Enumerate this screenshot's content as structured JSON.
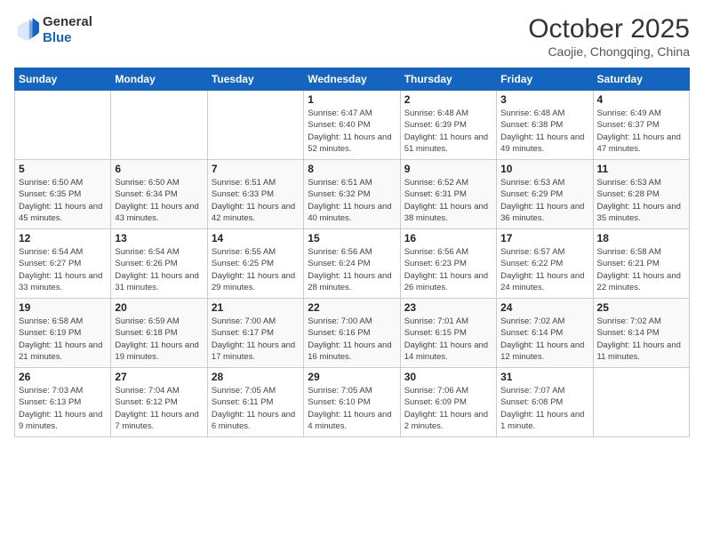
{
  "logo": {
    "line1": "General",
    "line2": "Blue"
  },
  "title": "October 2025",
  "subtitle": "Caojie, Chongqing, China",
  "days_of_week": [
    "Sunday",
    "Monday",
    "Tuesday",
    "Wednesday",
    "Thursday",
    "Friday",
    "Saturday"
  ],
  "weeks": [
    [
      {
        "day": "",
        "info": ""
      },
      {
        "day": "",
        "info": ""
      },
      {
        "day": "",
        "info": ""
      },
      {
        "day": "1",
        "info": "Sunrise: 6:47 AM\nSunset: 6:40 PM\nDaylight: 11 hours\nand 52 minutes."
      },
      {
        "day": "2",
        "info": "Sunrise: 6:48 AM\nSunset: 6:39 PM\nDaylight: 11 hours\nand 51 minutes."
      },
      {
        "day": "3",
        "info": "Sunrise: 6:48 AM\nSunset: 6:38 PM\nDaylight: 11 hours\nand 49 minutes."
      },
      {
        "day": "4",
        "info": "Sunrise: 6:49 AM\nSunset: 6:37 PM\nDaylight: 11 hours\nand 47 minutes."
      }
    ],
    [
      {
        "day": "5",
        "info": "Sunrise: 6:50 AM\nSunset: 6:35 PM\nDaylight: 11 hours\nand 45 minutes."
      },
      {
        "day": "6",
        "info": "Sunrise: 6:50 AM\nSunset: 6:34 PM\nDaylight: 11 hours\nand 43 minutes."
      },
      {
        "day": "7",
        "info": "Sunrise: 6:51 AM\nSunset: 6:33 PM\nDaylight: 11 hours\nand 42 minutes."
      },
      {
        "day": "8",
        "info": "Sunrise: 6:51 AM\nSunset: 6:32 PM\nDaylight: 11 hours\nand 40 minutes."
      },
      {
        "day": "9",
        "info": "Sunrise: 6:52 AM\nSunset: 6:31 PM\nDaylight: 11 hours\nand 38 minutes."
      },
      {
        "day": "10",
        "info": "Sunrise: 6:53 AM\nSunset: 6:29 PM\nDaylight: 11 hours\nand 36 minutes."
      },
      {
        "day": "11",
        "info": "Sunrise: 6:53 AM\nSunset: 6:28 PM\nDaylight: 11 hours\nand 35 minutes."
      }
    ],
    [
      {
        "day": "12",
        "info": "Sunrise: 6:54 AM\nSunset: 6:27 PM\nDaylight: 11 hours\nand 33 minutes."
      },
      {
        "day": "13",
        "info": "Sunrise: 6:54 AM\nSunset: 6:26 PM\nDaylight: 11 hours\nand 31 minutes."
      },
      {
        "day": "14",
        "info": "Sunrise: 6:55 AM\nSunset: 6:25 PM\nDaylight: 11 hours\nand 29 minutes."
      },
      {
        "day": "15",
        "info": "Sunrise: 6:56 AM\nSunset: 6:24 PM\nDaylight: 11 hours\nand 28 minutes."
      },
      {
        "day": "16",
        "info": "Sunrise: 6:56 AM\nSunset: 6:23 PM\nDaylight: 11 hours\nand 26 minutes."
      },
      {
        "day": "17",
        "info": "Sunrise: 6:57 AM\nSunset: 6:22 PM\nDaylight: 11 hours\nand 24 minutes."
      },
      {
        "day": "18",
        "info": "Sunrise: 6:58 AM\nSunset: 6:21 PM\nDaylight: 11 hours\nand 22 minutes."
      }
    ],
    [
      {
        "day": "19",
        "info": "Sunrise: 6:58 AM\nSunset: 6:19 PM\nDaylight: 11 hours\nand 21 minutes."
      },
      {
        "day": "20",
        "info": "Sunrise: 6:59 AM\nSunset: 6:18 PM\nDaylight: 11 hours\nand 19 minutes."
      },
      {
        "day": "21",
        "info": "Sunrise: 7:00 AM\nSunset: 6:17 PM\nDaylight: 11 hours\nand 17 minutes."
      },
      {
        "day": "22",
        "info": "Sunrise: 7:00 AM\nSunset: 6:16 PM\nDaylight: 11 hours\nand 16 minutes."
      },
      {
        "day": "23",
        "info": "Sunrise: 7:01 AM\nSunset: 6:15 PM\nDaylight: 11 hours\nand 14 minutes."
      },
      {
        "day": "24",
        "info": "Sunrise: 7:02 AM\nSunset: 6:14 PM\nDaylight: 11 hours\nand 12 minutes."
      },
      {
        "day": "25",
        "info": "Sunrise: 7:02 AM\nSunset: 6:14 PM\nDaylight: 11 hours\nand 11 minutes."
      }
    ],
    [
      {
        "day": "26",
        "info": "Sunrise: 7:03 AM\nSunset: 6:13 PM\nDaylight: 11 hours\nand 9 minutes."
      },
      {
        "day": "27",
        "info": "Sunrise: 7:04 AM\nSunset: 6:12 PM\nDaylight: 11 hours\nand 7 minutes."
      },
      {
        "day": "28",
        "info": "Sunrise: 7:05 AM\nSunset: 6:11 PM\nDaylight: 11 hours\nand 6 minutes."
      },
      {
        "day": "29",
        "info": "Sunrise: 7:05 AM\nSunset: 6:10 PM\nDaylight: 11 hours\nand 4 minutes."
      },
      {
        "day": "30",
        "info": "Sunrise: 7:06 AM\nSunset: 6:09 PM\nDaylight: 11 hours\nand 2 minutes."
      },
      {
        "day": "31",
        "info": "Sunrise: 7:07 AM\nSunset: 6:08 PM\nDaylight: 11 hours\nand 1 minute."
      },
      {
        "day": "",
        "info": ""
      }
    ]
  ]
}
